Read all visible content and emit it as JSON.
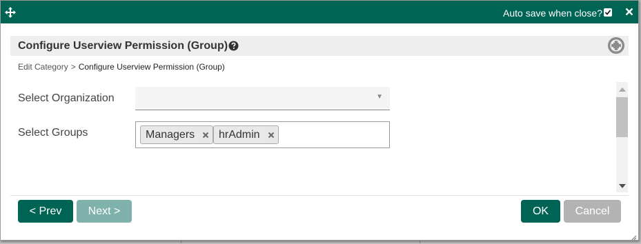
{
  "titlebar": {
    "autosave_label": "Auto save when close?",
    "autosave_checked": true,
    "close_label": "✕"
  },
  "header": {
    "title": "Configure Userview Permission (Group)"
  },
  "breadcrumb": {
    "parent": "Edit Category",
    "separator": ">",
    "current": "Configure Userview Permission (Group)"
  },
  "form": {
    "organization_label": "Select Organization",
    "organization_value": "",
    "groups_label": "Select Groups",
    "groups": [
      "Managers",
      "hrAdmin"
    ]
  },
  "buttons": {
    "prev": "< Prev",
    "next": "Next >",
    "ok": "OK",
    "cancel": "Cancel"
  },
  "colors": {
    "primary": "#006455",
    "primary_disabled": "#7fb2aa",
    "cancel": "#b3b3b3"
  }
}
